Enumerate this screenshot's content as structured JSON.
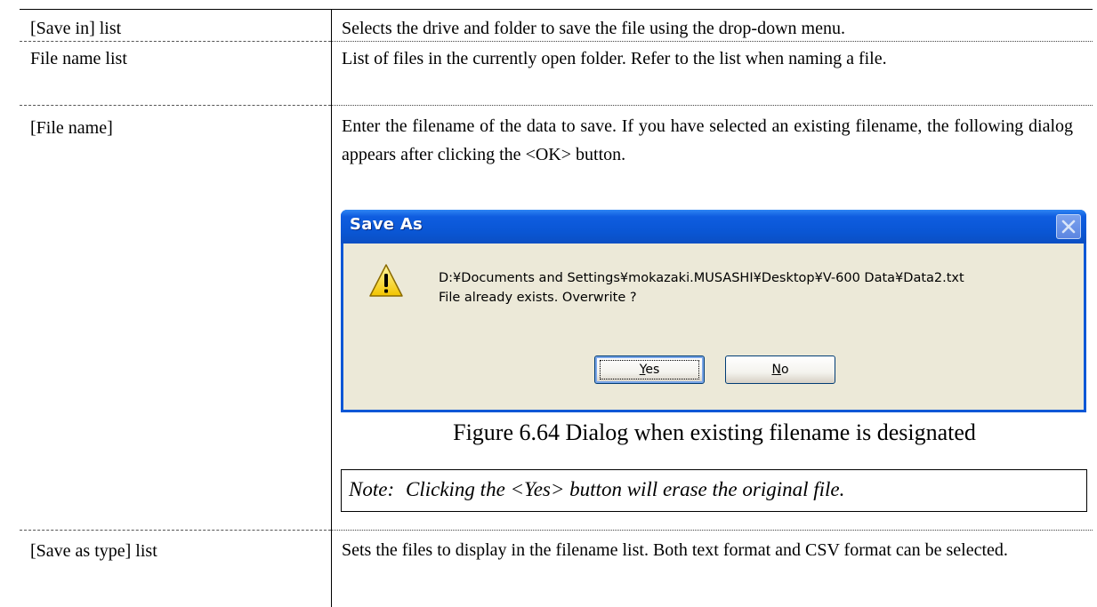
{
  "rows": [
    {
      "term": "[Save in] list",
      "desc": "Selects the drive and folder to save the file using the drop-down menu."
    },
    {
      "term": "File name list",
      "desc": "List of files in the currently open folder. Refer to the list when naming a file."
    },
    {
      "term": "[File name]",
      "desc": "Enter the filename of the data to save. If you have selected an existing filename, the following dialog appears after clicking the <OK> button."
    },
    {
      "term": "[Save as type] list",
      "desc": "Sets the files to display in the filename list. Both text format and CSV format can be selected."
    }
  ],
  "dialog": {
    "title": "Save As",
    "path": "D:¥Documents and Settings¥mokazaki.MUSASHI¥Desktop¥V-600 Data¥Data2.txt",
    "message": "File already exists. Overwrite ?",
    "yes_mnemonic": "Y",
    "yes_rest": "es",
    "no_mnemonic": "N",
    "no_rest": "o",
    "icon": "warning-icon",
    "colors": {
      "titlebar": "#0a56d4",
      "client": "#ece9d8"
    }
  },
  "caption": "Figure 6.64 Dialog when existing filename is designated",
  "note": {
    "label": "Note:",
    "text": "Clicking the <Yes> button will erase the original file."
  }
}
